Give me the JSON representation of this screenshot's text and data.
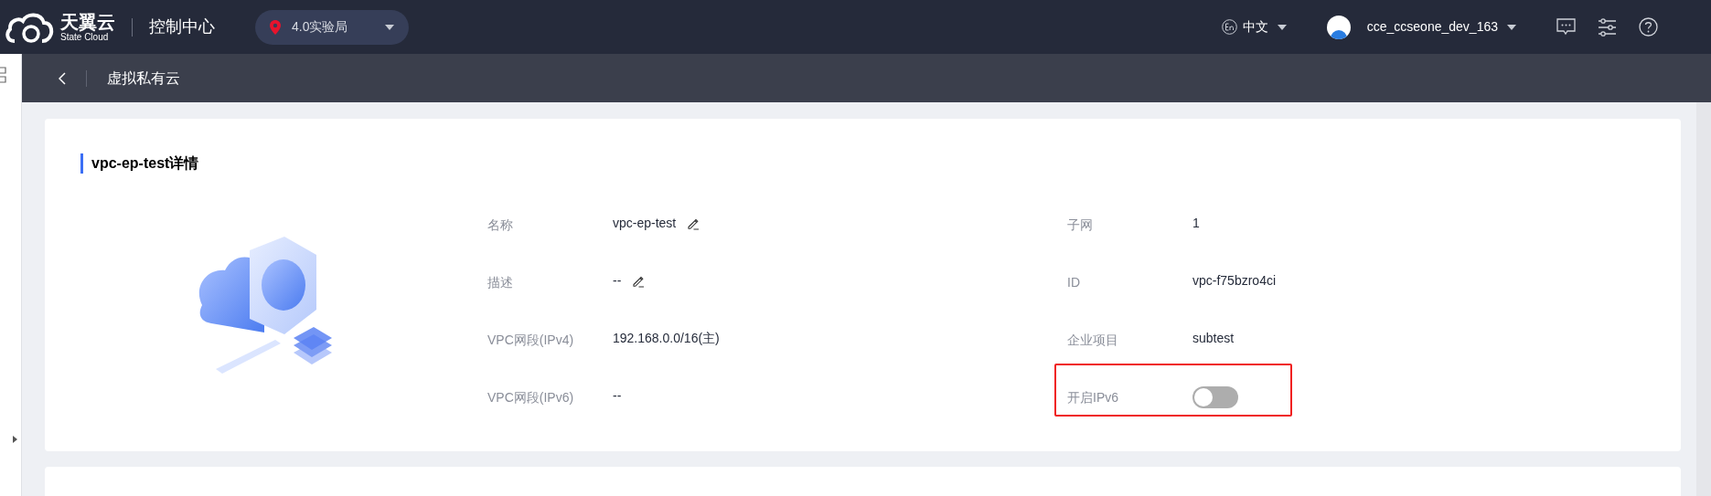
{
  "topbar": {
    "logo_cn": "天翼云",
    "logo_en": "State Cloud",
    "console": "控制中心",
    "region": "4.0实验局",
    "language": "中文",
    "user": "cce_ccseone_dev_163"
  },
  "subheader": {
    "title": "虚拟私有云"
  },
  "detail": {
    "title": "vpc-ep-test详情",
    "fields": [
      {
        "kind": "editable",
        "label": "名称",
        "value": "vpc-ep-test"
      },
      {
        "kind": "text",
        "label": "子网",
        "value": "1"
      },
      {
        "kind": "editable",
        "label": "描述",
        "value": "--"
      },
      {
        "kind": "text",
        "label": "ID",
        "value": "vpc-f75bzro4ci"
      },
      {
        "kind": "text",
        "label": "VPC网段(IPv4)",
        "value": "192.168.0.0/16(主)"
      },
      {
        "kind": "text",
        "label": "企业项目",
        "value": "subtest"
      },
      {
        "kind": "text",
        "label": "VPC网段(IPv6)",
        "value": "--"
      },
      {
        "kind": "switch",
        "label": "开启IPv6",
        "on": false,
        "highlighted": true
      }
    ]
  }
}
